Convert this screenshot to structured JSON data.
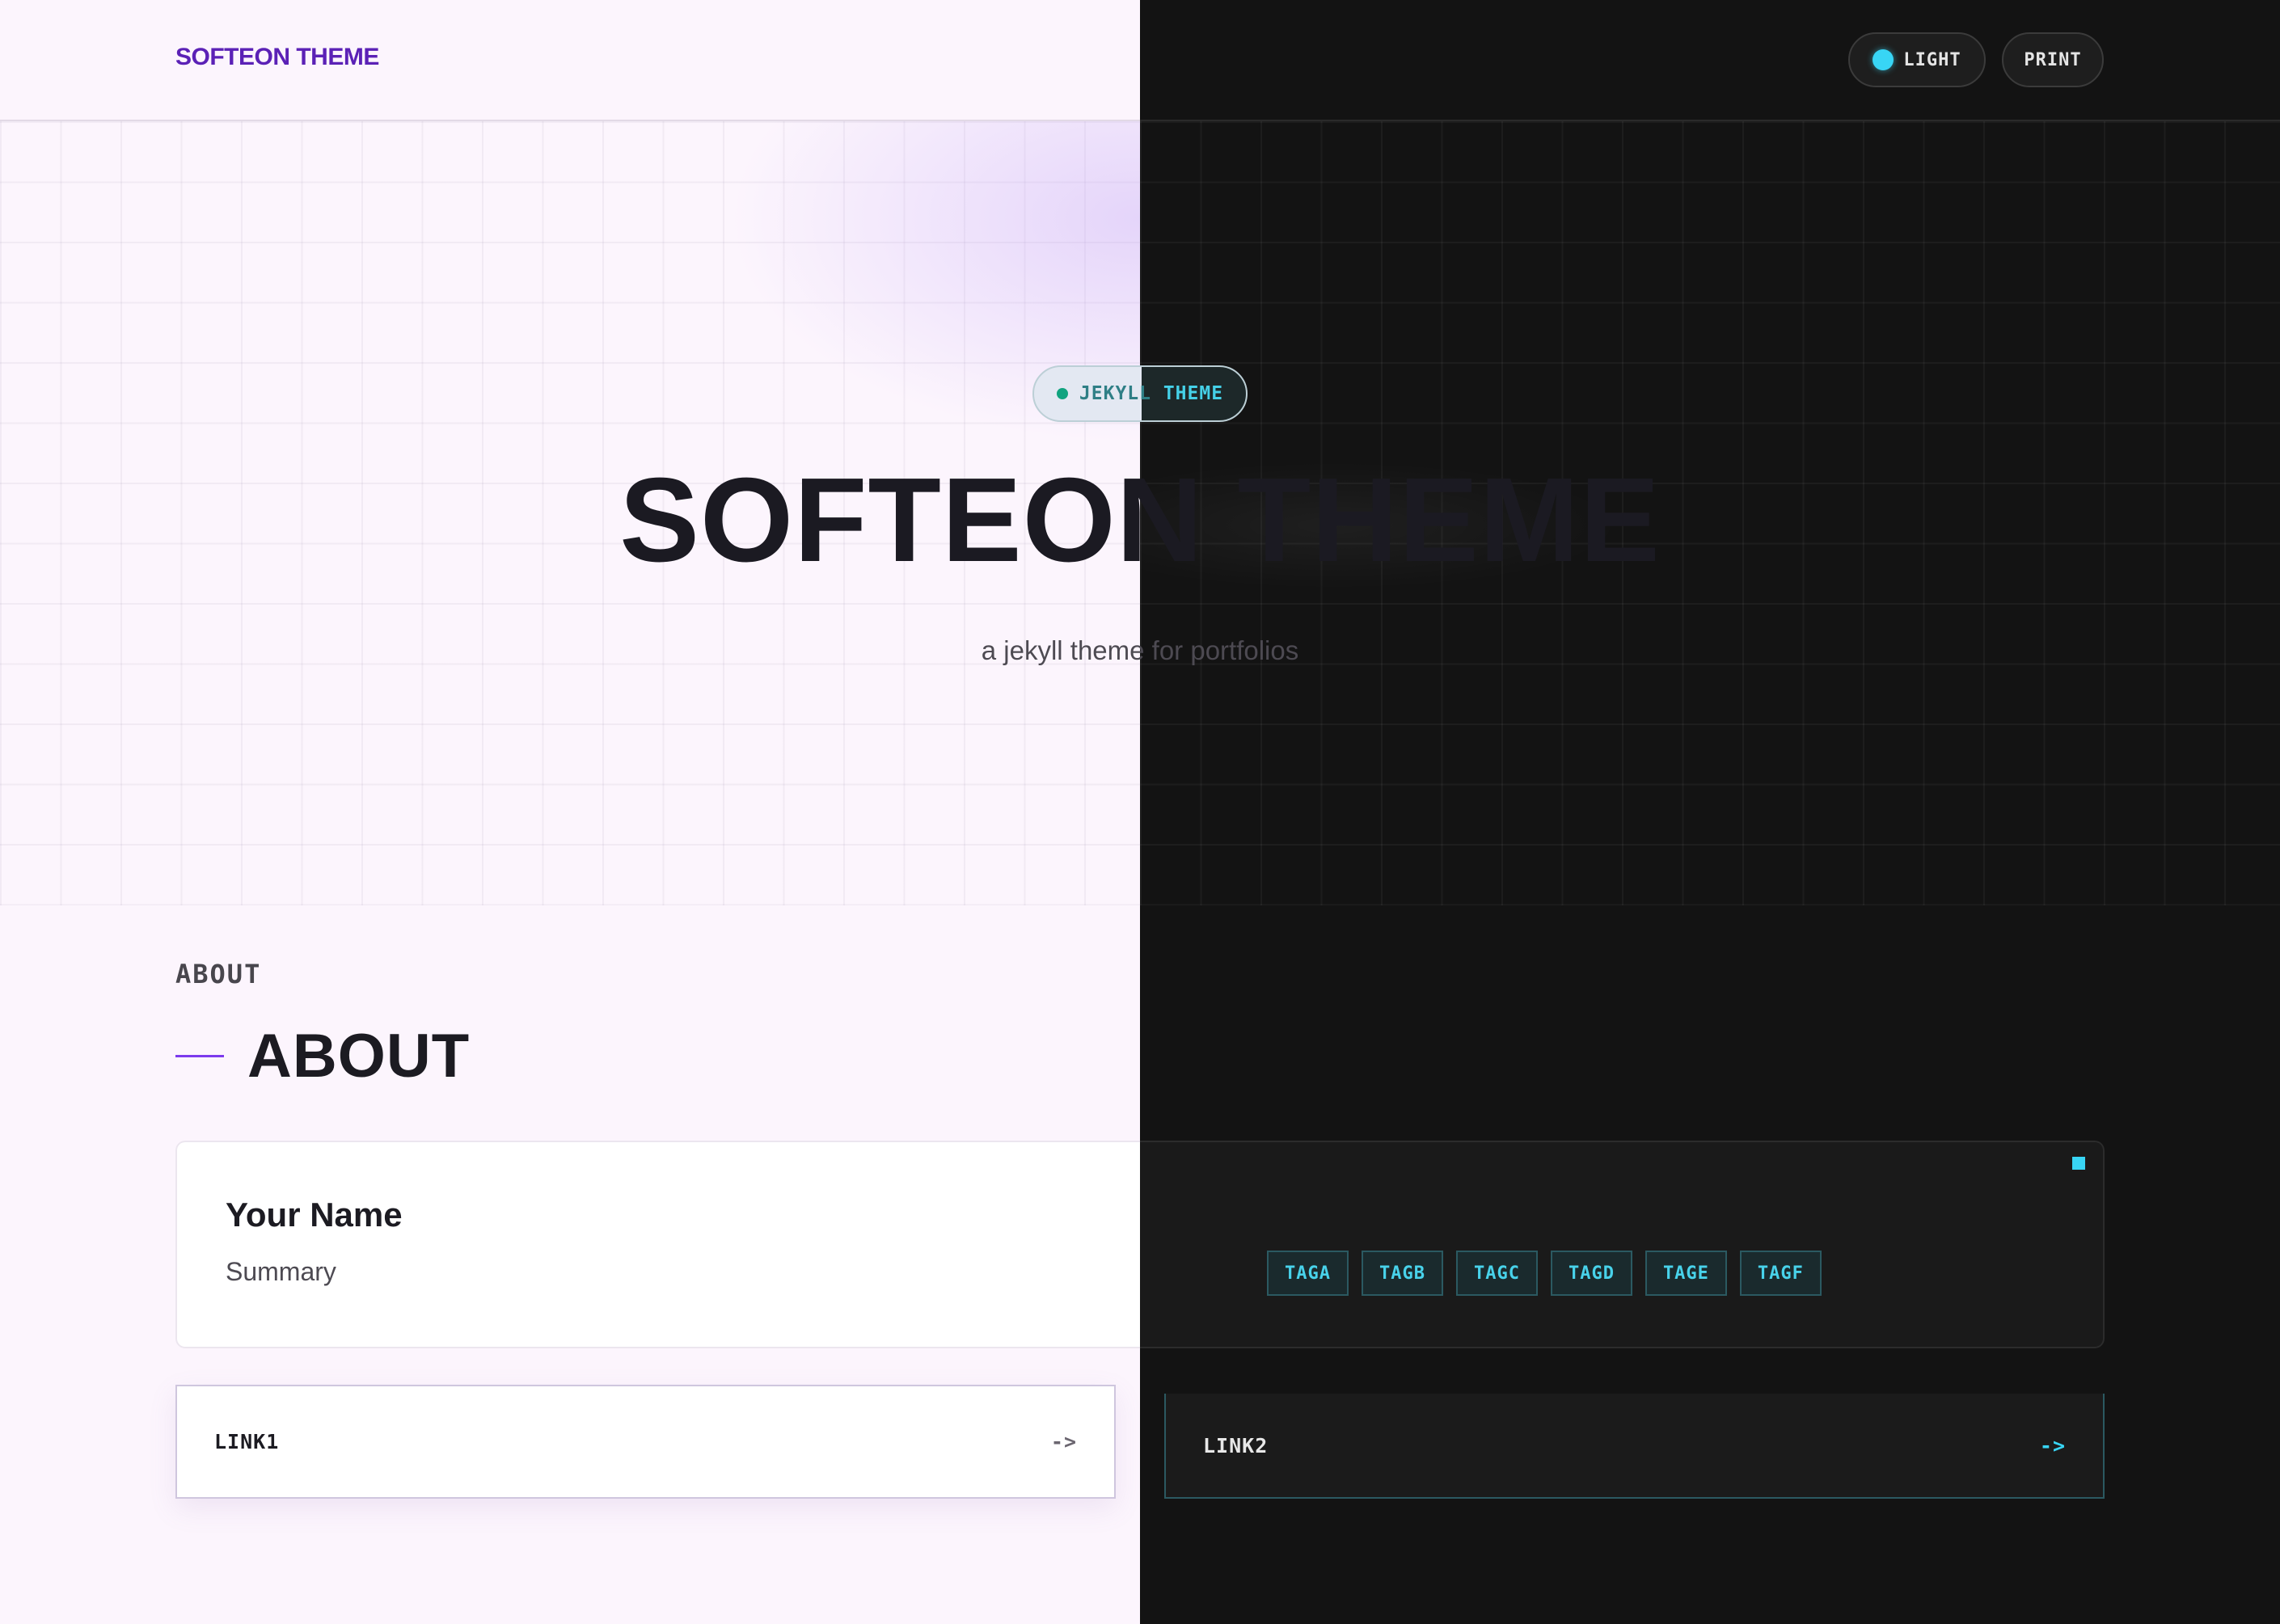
{
  "header": {
    "brand": "SOFTEON THEME",
    "theme_toggle_label": "LIGHT",
    "print_label": "PRINT"
  },
  "hero": {
    "badge": "JEKYLL THEME",
    "title": "SOFTEON THEME",
    "subtitle": "a jekyll theme for portfolios"
  },
  "about": {
    "kicker": "ABOUT",
    "heading": "ABOUT",
    "name": "Your Name",
    "summary": "Summary",
    "tags": [
      "TAGA",
      "TAGB",
      "TAGC",
      "TAGD",
      "TAGE",
      "TAGF"
    ]
  },
  "links": [
    {
      "label": "LINK1",
      "arrow": "->"
    },
    {
      "label": "LINK2",
      "arrow": "->"
    }
  ],
  "colors": {
    "accent_purple": "#5b21b6",
    "accent_cyan": "#38d5f5",
    "badge_dot": "#10a37f",
    "light_bg": "#fcf5fd",
    "dark_bg": "#131313"
  },
  "icons": {
    "theme_toggle": "circle-dot-icon",
    "badge": "status-dot-icon",
    "card_corner": "square-icon"
  }
}
